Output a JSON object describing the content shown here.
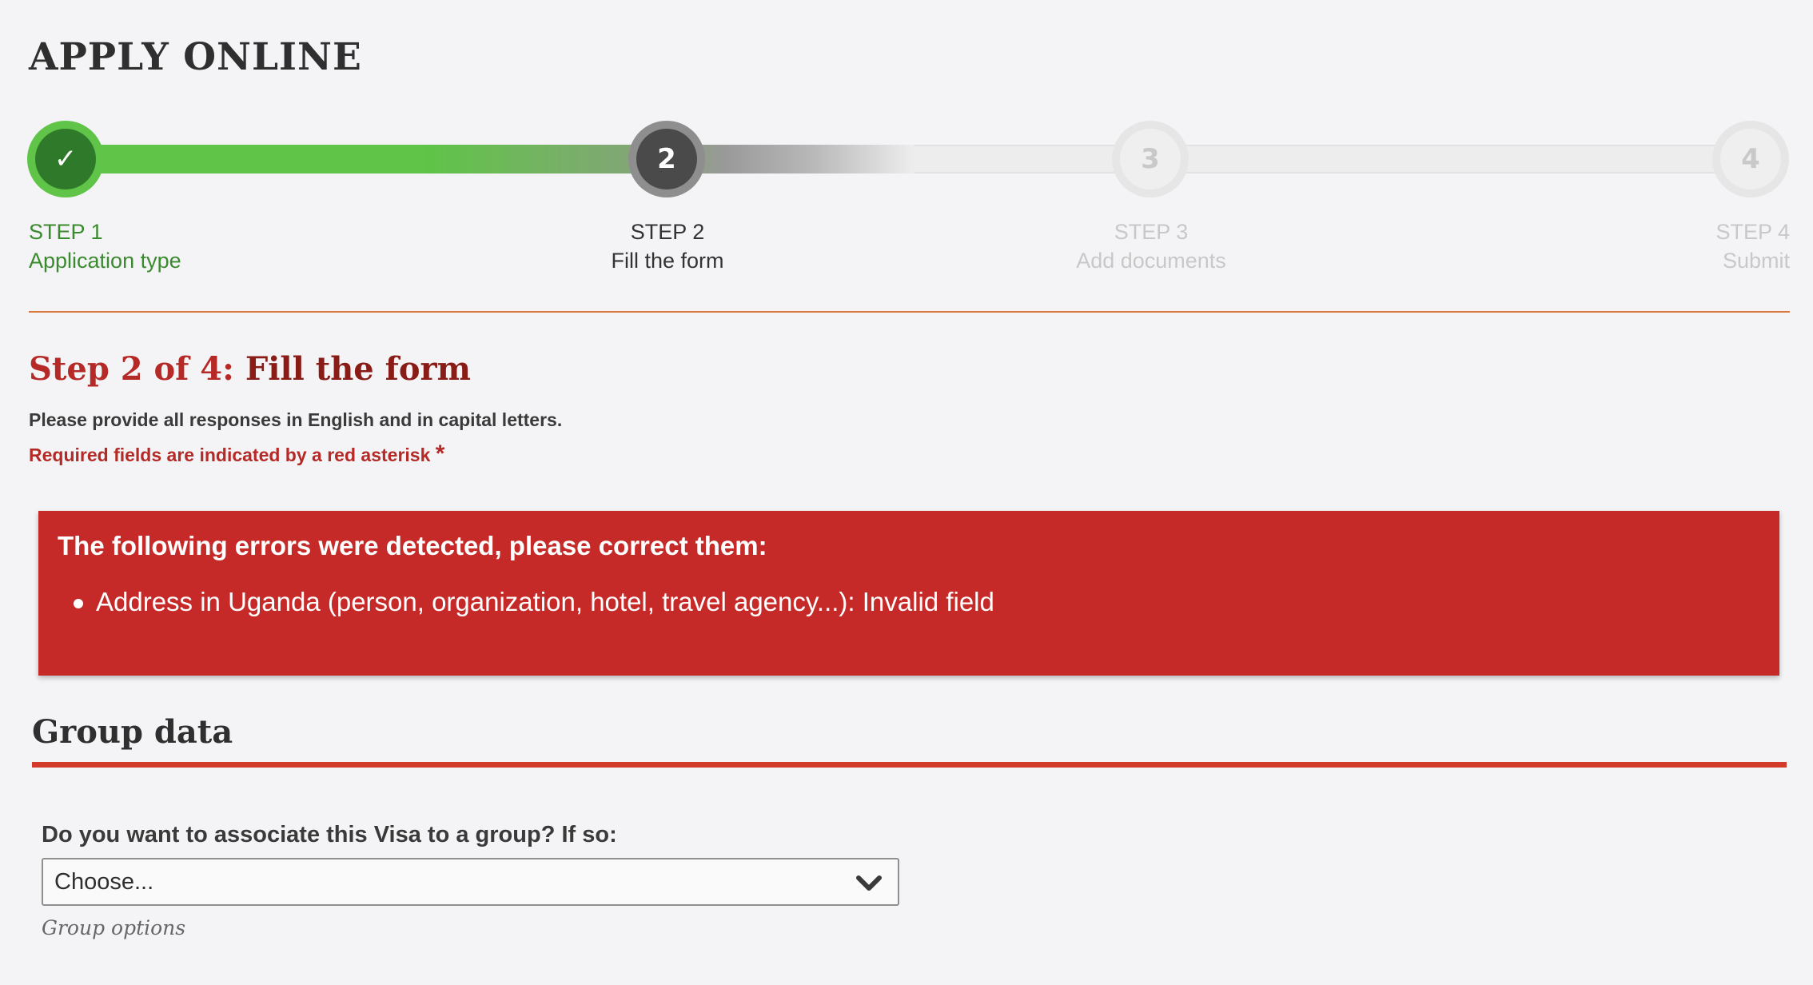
{
  "page": {
    "title": "APPLY ONLINE"
  },
  "progress": {
    "steps": [
      {
        "number": "✓",
        "step": "STEP 1",
        "label": "Application type",
        "state": "complete"
      },
      {
        "number": "2",
        "step": "STEP 2",
        "label": "Fill the form",
        "state": "current"
      },
      {
        "number": "3",
        "step": "STEP 3",
        "label": "Add documents",
        "state": "upcoming"
      },
      {
        "number": "4",
        "step": "STEP 4",
        "label": "Submit",
        "state": "upcoming"
      }
    ],
    "colors": {
      "complete": "#5fc447",
      "current": "#4a4a4a",
      "upcoming": "#c8c8c8"
    }
  },
  "form_header": {
    "step_prefix": "Step 2 of 4:",
    "step_name": "Fill the form",
    "instruction": "Please provide all responses in English and in capital letters.",
    "required_note": "Required fields are indicated by a red asterisk",
    "asterisk": "*"
  },
  "errors": {
    "title": "The following errors were detected, please correct them:",
    "items": [
      "Address in Uganda (person, organization, hotel, travel agency...): Invalid field"
    ],
    "color": "#c62a28"
  },
  "group_section": {
    "title": "Group data",
    "question": "Do you want to associate this Visa to a group? If so:",
    "select_value": "Choose...",
    "hint": "Group options",
    "icon": "chevron-down-icon"
  }
}
